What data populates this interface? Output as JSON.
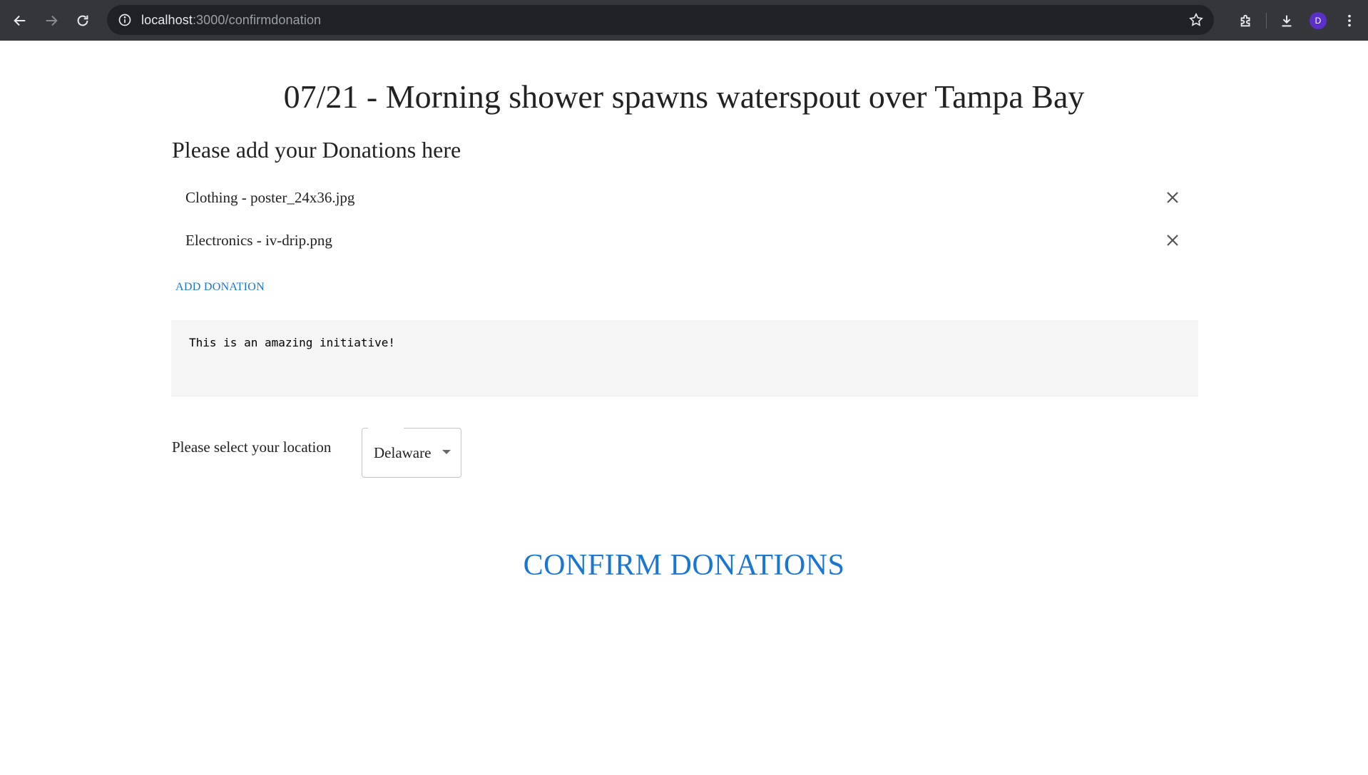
{
  "browser": {
    "url_host": "localhost",
    "url_path": ":3000/confirmdonation",
    "avatar_letter": "D",
    "accent_avatar_color": "#5b2fc9"
  },
  "page": {
    "title": "07/21 - Morning shower spawns waterspout over Tampa Bay",
    "section_title": "Please add your Donations here",
    "donations": [
      {
        "label": "Clothing - poster_24x36.jpg"
      },
      {
        "label": "Electronics - iv-drip.png"
      }
    ],
    "add_donation_label": "ADD DONATION",
    "comment_value": "This is an amazing initiative!",
    "location_label": "Please select your location",
    "location_selected": "Delaware",
    "confirm_label": "CONFIRM DONATIONS",
    "accent_color": "#1976d2"
  }
}
